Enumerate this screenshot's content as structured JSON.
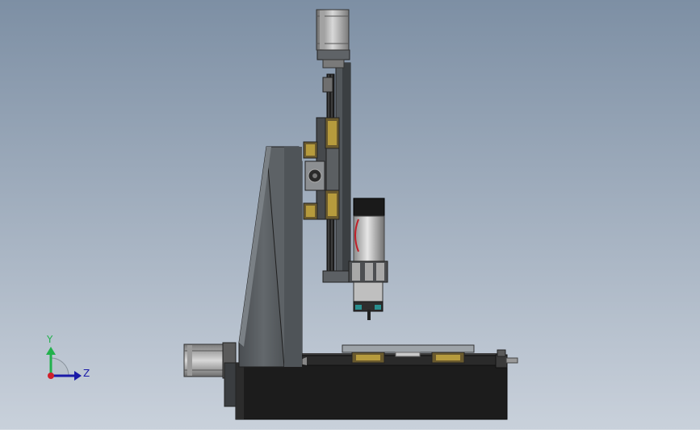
{
  "viewport": {
    "background_top": "#7d8fa4",
    "background_bottom": "#c9d1db",
    "model": "cnc-milling-machine-side-view"
  },
  "triad": {
    "y_label": "Y",
    "z_label": "Z",
    "y_color": "#22b14c",
    "z_color": "#1a1aa8",
    "origin_color": "#d0202a"
  }
}
